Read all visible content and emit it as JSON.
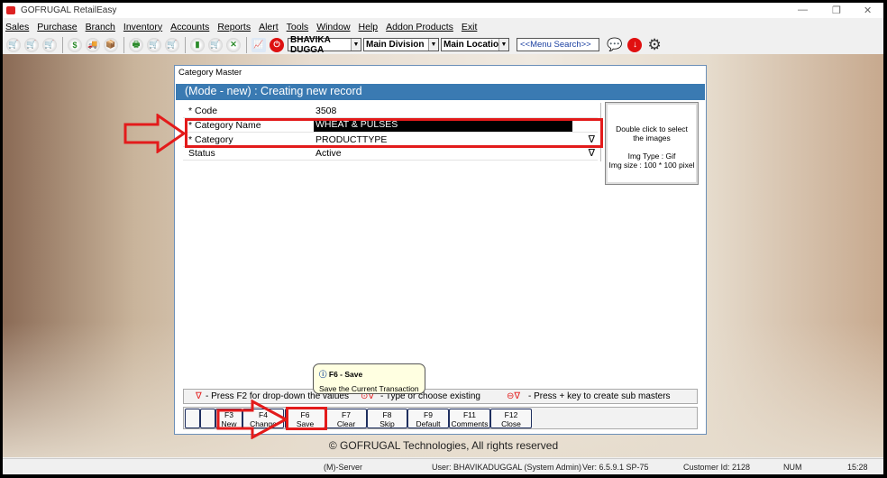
{
  "app": {
    "title": "GOFRUGAL RetailEasy"
  },
  "menu": [
    "Sales",
    "Purchase",
    "Branch",
    "Inventory",
    "Accounts",
    "Reports",
    "Alert",
    "Tools",
    "Window",
    "Help",
    "Addon Products",
    "Exit"
  ],
  "toolbar": {
    "user_select": "BHAVIKA DUGGA",
    "division_select": "Main Division",
    "location_select": "Main Location",
    "search_placeholder": "<<Menu Search>>"
  },
  "dialog": {
    "title": "Category Master",
    "header": "(Mode - new) : Creating new record",
    "fields": [
      {
        "label": "* Code",
        "value": "3508"
      },
      {
        "label": "* Category Name",
        "value": "WHEAT & PULSES"
      },
      {
        "label": "* Category",
        "value": "PRODUCTTYPE"
      },
      {
        "label": "Status",
        "value": "Active"
      }
    ],
    "image_box": {
      "line1": "Double click to select the images",
      "line2": "Img Type : Gif",
      "line3": "Img size : 100 * 100 pixel"
    },
    "hints": [
      "- Press F2 for drop-down the values",
      "- Type or choose existing",
      "- Press + key to create sub masters"
    ],
    "buttons": [
      {
        "key": "F3",
        "label": "New"
      },
      {
        "key": "F4",
        "label": "Change"
      },
      {
        "key": "F6",
        "label": "Save"
      },
      {
        "key": "F7",
        "label": "Clear"
      },
      {
        "key": "F8",
        "label": "Skip"
      },
      {
        "key": "F9",
        "label": "Default"
      },
      {
        "key": "F11",
        "label": "Comments"
      },
      {
        "key": "F12",
        "label": "Close"
      }
    ],
    "tooltip": {
      "title": "F6 - Save",
      "text": "Save the Current Transaction"
    }
  },
  "copyright": "© GOFRUGAL Technologies, All rights reserved",
  "statusbar": {
    "server": "(M)-Server",
    "user": "User: BHAVIKADUGGAL (System Admin)",
    "version": "Ver: 6.5.9.1 SP-75",
    "customer": "Customer Id: 2128",
    "num": "NUM",
    "time": "15:28"
  },
  "colors": {
    "header": "#3a7ab2",
    "annotation": "#e31b1b"
  }
}
